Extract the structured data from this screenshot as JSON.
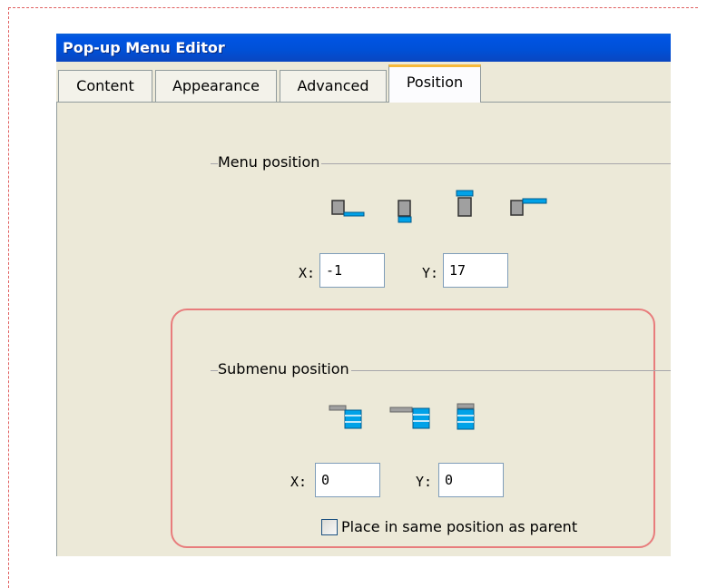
{
  "window": {
    "title": "Pop-up Menu Editor"
  },
  "tabs": [
    {
      "label": "Content",
      "active": false
    },
    {
      "label": "Appearance",
      "active": false
    },
    {
      "label": "Advanced",
      "active": false
    },
    {
      "label": "Position",
      "active": true
    }
  ],
  "menu_position": {
    "label": "Menu position",
    "icons": [
      "menu-below-right-icon",
      "menu-below-icon",
      "menu-above-icon",
      "menu-right-icon"
    ],
    "x_label": "X:",
    "x_value": "-1",
    "y_label": "Y:",
    "y_value": "17"
  },
  "submenu_position": {
    "label": "Submenu position",
    "icons": [
      "submenu-top-right-icon",
      "submenu-right-icon",
      "submenu-below-icon"
    ],
    "x_label": "X:",
    "x_value": "0",
    "y_label": "Y:",
    "y_value": "0",
    "checkbox_label": "Place in same position as parent",
    "checkbox_checked": false
  },
  "colors": {
    "accent": "#0054e3",
    "highlight": "#e87c7c",
    "tab_active": "#f6b93b",
    "icon_blue": "#00a2e8"
  }
}
